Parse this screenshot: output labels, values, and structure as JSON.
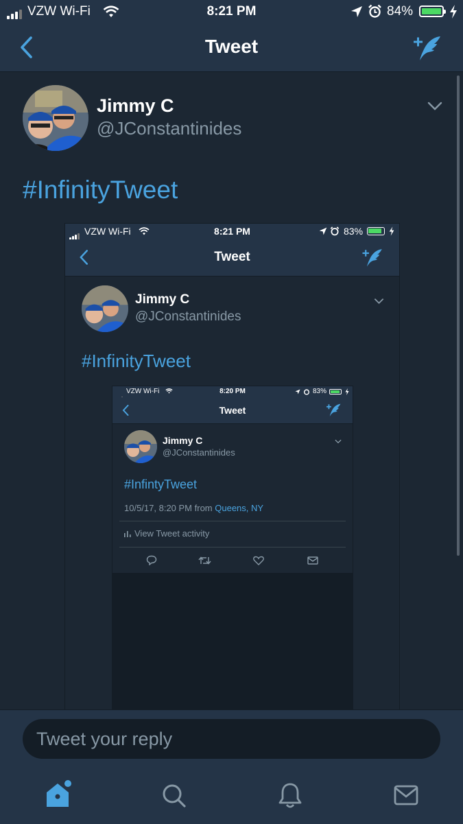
{
  "status_bar": {
    "carrier": "VZW Wi-Fi",
    "time": "8:21 PM",
    "battery": "84%"
  },
  "nav": {
    "title": "Tweet"
  },
  "tweet": {
    "name": "Jimmy C",
    "handle": "@JConstantinides",
    "text": "#InfinityTweet"
  },
  "nested1": {
    "status_bar": {
      "carrier": "VZW Wi-Fi",
      "time": "8:21 PM",
      "battery": "83%"
    },
    "nav": {
      "title": "Tweet"
    },
    "tweet": {
      "name": "Jimmy C",
      "handle": "@JConstantinides",
      "text": "#InfinityTweet"
    }
  },
  "nested2": {
    "status_bar": {
      "carrier": "VZW Wi-Fi",
      "time": "8:20 PM",
      "battery": "83%"
    },
    "nav": {
      "title": "Tweet"
    },
    "tweet": {
      "name": "Jimmy C",
      "handle": "@JConstantinides",
      "text": "#InfintyTweet",
      "timestamp": "10/5/17, 8:20 PM from",
      "location": "Queens, NY",
      "activity": "View Tweet activity"
    }
  },
  "reply": {
    "placeholder": "Tweet your reply"
  },
  "tabbar": {
    "items": [
      "home-icon",
      "search-icon",
      "notifications-icon",
      "messages-icon"
    ]
  },
  "colors": {
    "accent": "#4aa3df",
    "background": "#1c2733",
    "bar": "#243447"
  }
}
